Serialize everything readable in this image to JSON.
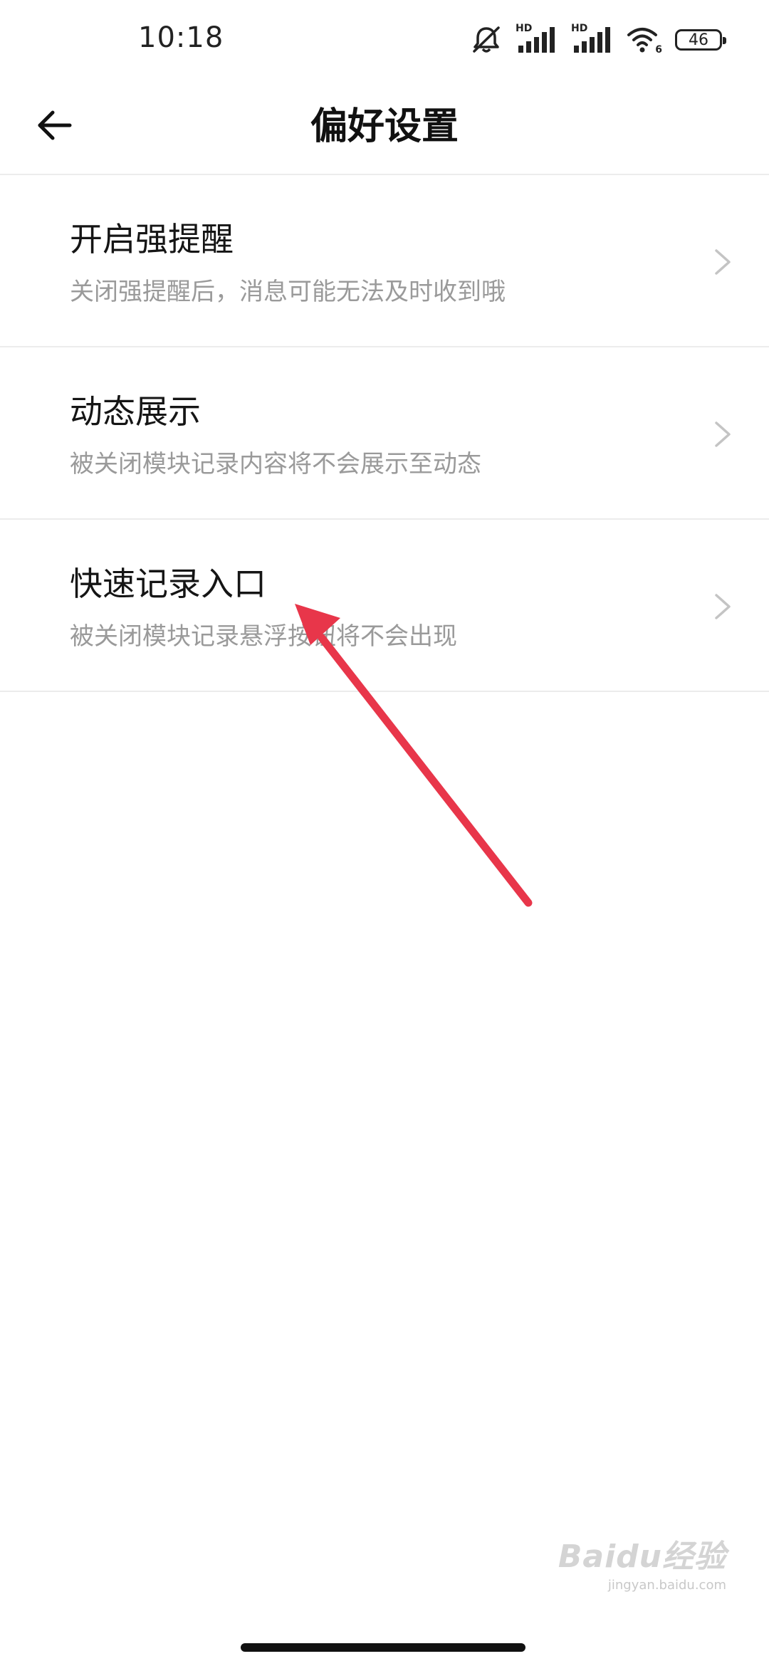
{
  "status_bar": {
    "time": "10:18",
    "icons": [
      "mute-icon",
      "hd-signal-icon",
      "hd-signal-icon",
      "wifi-icon",
      "battery-icon"
    ],
    "signal_label_1": "HD",
    "signal_label_2": "HD",
    "wifi_label": "6",
    "battery_level": "46"
  },
  "header": {
    "title": "偏好设置",
    "back_icon": "back-arrow-icon"
  },
  "settings": [
    {
      "title": "开启强提醒",
      "description": "关闭强提醒后，消息可能无法及时收到哦"
    },
    {
      "title": "动态展示",
      "description": "被关闭模块记录内容将不会展示至动态"
    },
    {
      "title": "快速记录入口",
      "description": "被关闭模块记录悬浮按钮将不会出现"
    }
  ],
  "annotation": {
    "color": "#e8364a"
  },
  "watermark": {
    "logo": "Baidu经验",
    "url": "jingyan.baidu.com"
  }
}
